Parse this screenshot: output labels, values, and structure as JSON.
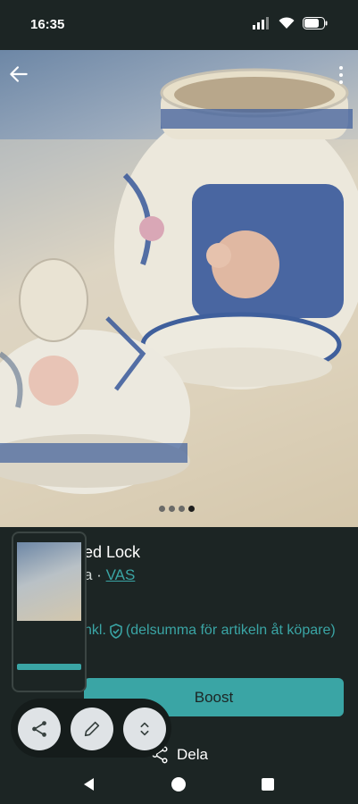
{
  "status_bar": {
    "time": "16:35"
  },
  "listing": {
    "title_visible": "ed Lock",
    "subtitle_prefix": "a ·",
    "category": "VAS",
    "price_suffix": "nkl.",
    "fee_note": "(delsumma för artikeln åt köpare)"
  },
  "carousel": {
    "count": 4,
    "active_index": 3
  },
  "actions": {
    "boost_label": "Boost",
    "share_label": "Dela"
  },
  "colors": {
    "accent": "#3aa5a5",
    "background": "#1c2524",
    "fab": "#dfe3e6"
  },
  "icons": [
    "back-arrow-icon",
    "more-vert-icon",
    "shield-check-icon",
    "share-icon",
    "pencil-icon",
    "chevron-up-down-icon"
  ]
}
